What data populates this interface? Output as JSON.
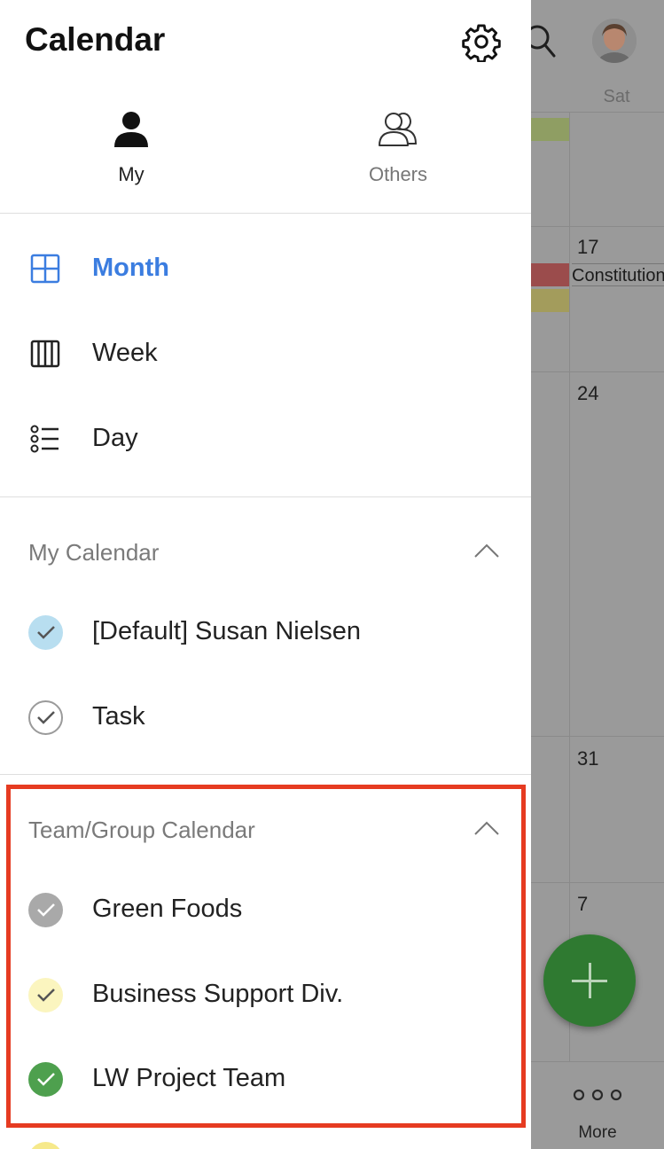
{
  "app": {
    "title": "Calendar"
  },
  "tabs": [
    {
      "label": "My",
      "icon": "person-icon",
      "selected": true
    },
    {
      "label": "Others",
      "icon": "people-icon",
      "selected": false
    }
  ],
  "views": [
    {
      "label": "Month",
      "icon": "grid-icon",
      "selected": true
    },
    {
      "label": "Week",
      "icon": "columns-icon",
      "selected": false
    },
    {
      "label": "Day",
      "icon": "list-icon",
      "selected": false
    }
  ],
  "sections": {
    "my_calendar": {
      "title": "My Calendar",
      "items": [
        {
          "label": "[Default] Susan Nielsen",
          "color": "#b8def0",
          "checked": true
        },
        {
          "label": "Task",
          "color": "#ffffff",
          "checked": true
        }
      ]
    },
    "team_calendar": {
      "title": "Team/Group Calendar",
      "items": [
        {
          "label": "Green Foods",
          "color": "#a9a9a9",
          "checked": true
        },
        {
          "label": "Business Support Div.",
          "color": "#fbf5bf",
          "checked": true
        },
        {
          "label": "LW Project Team",
          "color": "#4ea04e",
          "checked": true
        }
      ]
    }
  },
  "background": {
    "day_header": "Sat",
    "dates": [
      "17",
      "24",
      "31",
      "7"
    ],
    "event_label": "Constitution Day",
    "more_label": "More"
  },
  "colors": {
    "accent": "#3b7de0",
    "highlight": "#e63b21",
    "fab": "#2f7a31"
  }
}
